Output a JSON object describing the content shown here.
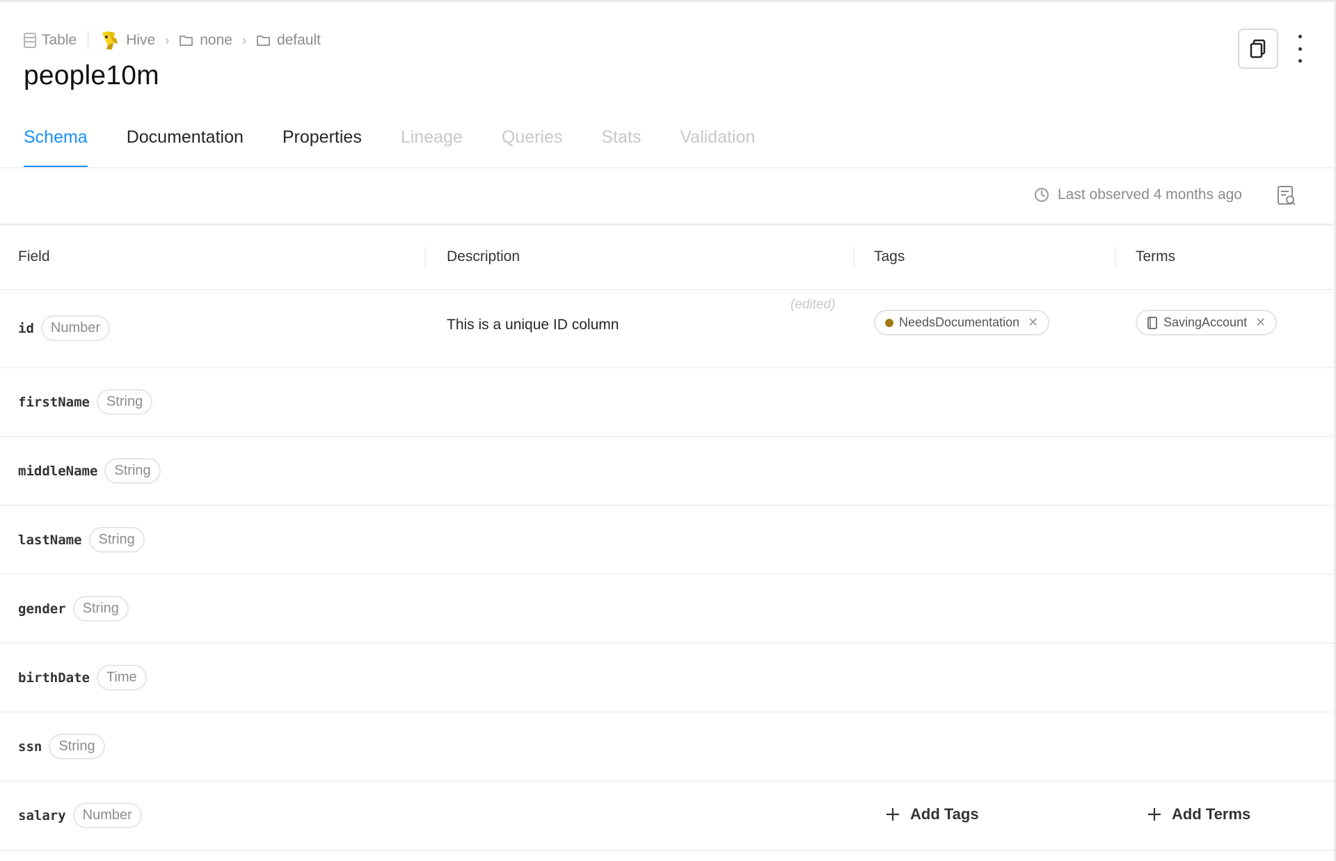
{
  "breadcrumb": {
    "entity_type": "Table",
    "platform": "Hive",
    "path": [
      "none",
      "default"
    ]
  },
  "title": "people10m",
  "tabs": [
    {
      "label": "Schema",
      "state": "active"
    },
    {
      "label": "Documentation",
      "state": "enabled"
    },
    {
      "label": "Properties",
      "state": "enabled"
    },
    {
      "label": "Lineage",
      "state": "disabled"
    },
    {
      "label": "Queries",
      "state": "disabled"
    },
    {
      "label": "Stats",
      "state": "disabled"
    },
    {
      "label": "Validation",
      "state": "disabled"
    }
  ],
  "toolbar": {
    "last_observed": "Last observed 4 months ago"
  },
  "table": {
    "headers": {
      "field": "Field",
      "description": "Description",
      "tags": "Tags",
      "terms": "Terms"
    },
    "rows": [
      {
        "name": "id",
        "type": "Number",
        "description": "This is a unique ID column",
        "edited": "(edited)",
        "tag": "NeedsDocumentation",
        "term": "SavingAccount"
      },
      {
        "name": "firstName",
        "type": "String"
      },
      {
        "name": "middleName",
        "type": "String"
      },
      {
        "name": "lastName",
        "type": "String"
      },
      {
        "name": "gender",
        "type": "String"
      },
      {
        "name": "birthDate",
        "type": "Time"
      },
      {
        "name": "ssn",
        "type": "String"
      },
      {
        "name": "salary",
        "type": "Number",
        "add_tags": "Add Tags",
        "add_terms": "Add Terms"
      }
    ]
  },
  "colors": {
    "accent": "#1890ff",
    "tag_dot": "#a07a10",
    "disabled_text": "#c8c8c8",
    "muted_text": "#8c8c8c"
  },
  "icons": {
    "entity": "table-icon",
    "platform": "hive-logo-icon",
    "folder": "folder-icon",
    "copy": "copy-icon",
    "more": "kebab-menu-icon",
    "clock": "clock-icon",
    "report": "report-icon",
    "term": "book-icon",
    "add": "plus-icon",
    "remove": "close-icon"
  }
}
